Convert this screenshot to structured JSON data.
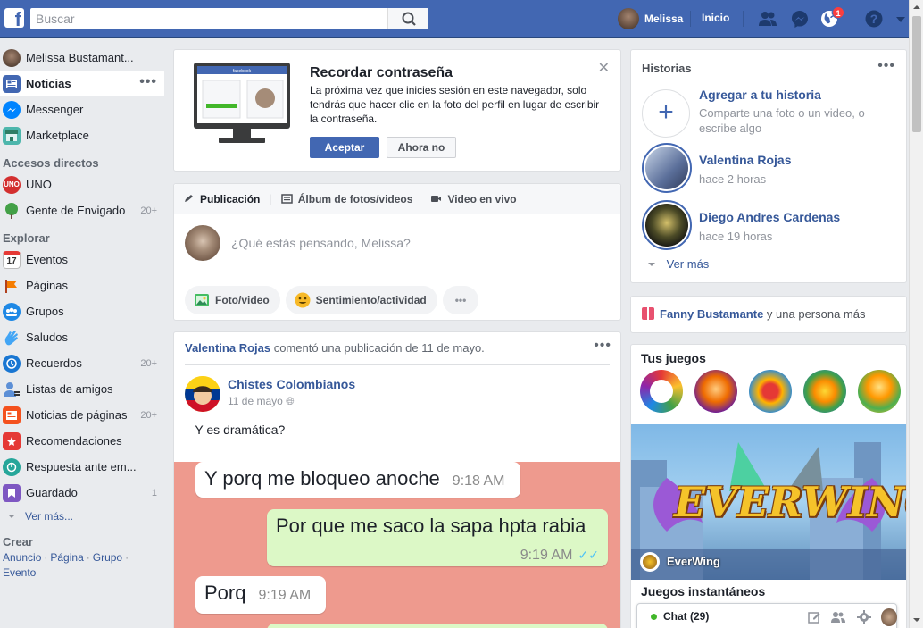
{
  "topbar": {
    "logo": "f",
    "search_placeholder": "Buscar",
    "user_name": "Melissa",
    "home_label": "Inicio",
    "notifications_count": "1"
  },
  "leftnav": {
    "profile_name": "Melissa Bustamant...",
    "main_items": [
      {
        "label": "Noticias",
        "icon": "news-feed-icon",
        "active": true
      },
      {
        "label": "Messenger",
        "icon": "messenger-icon"
      },
      {
        "label": "Marketplace",
        "icon": "marketplace-icon"
      }
    ],
    "shortcuts_header": "Accesos directos",
    "shortcuts": [
      {
        "label": "UNO",
        "icon": "uno-icon"
      },
      {
        "label": "Gente de Envigado",
        "icon": "tree-icon",
        "count": "20+"
      }
    ],
    "explore_header": "Explorar",
    "explore": [
      {
        "label": "Eventos",
        "icon": "calendar-icon",
        "badge": "17"
      },
      {
        "label": "Páginas",
        "icon": "flag-icon"
      },
      {
        "label": "Grupos",
        "icon": "groups-icon"
      },
      {
        "label": "Saludos",
        "icon": "wave-icon"
      },
      {
        "label": "Recuerdos",
        "icon": "memories-icon",
        "count": "20+"
      },
      {
        "label": "Listas de amigos",
        "icon": "friends-list-icon"
      },
      {
        "label": "Noticias de páginas",
        "icon": "pages-feed-icon",
        "count": "20+"
      },
      {
        "label": "Recomendaciones",
        "icon": "recommendations-icon"
      },
      {
        "label": "Respuesta ante em...",
        "icon": "crisis-response-icon"
      },
      {
        "label": "Guardado",
        "icon": "saved-icon",
        "count": "1"
      }
    ],
    "see_more": "Ver más...",
    "create_header": "Crear",
    "create_links": [
      "Anuncio",
      "Página",
      "Grupo",
      "Evento"
    ]
  },
  "password_card": {
    "title": "Recordar contraseña",
    "body": "La próxima vez que inicies sesión en este navegador, solo tendrás que hacer clic en la foto del perfil en lugar de escribir la contraseña.",
    "accept": "Aceptar",
    "decline": "Ahora no",
    "monitor_brand": "facebook"
  },
  "composer": {
    "tabs": [
      "Publicación",
      "Álbum de fotos/videos",
      "Video en vivo"
    ],
    "placeholder": "¿Qué estás pensando, Melissa?",
    "chips": [
      "Foto/video",
      "Sentimiento/actividad"
    ]
  },
  "post": {
    "actor": "Valentina Rojas",
    "activity": " comentó una publicación de 11 de mayo.",
    "page_name": "Chistes Colombianos",
    "date": "11 de mayo",
    "text_line1": "– Y es dramática?",
    "text_line2": "–",
    "messages": [
      {
        "text": "Y porq me bloqueo anoche",
        "time": "9:18 AM",
        "side": "in"
      },
      {
        "text": "Por que me saco la sapa hpta rabia",
        "time": "9:19 AM",
        "side": "out"
      },
      {
        "text": "Porq",
        "time": "9:19 AM",
        "side": "in"
      }
    ]
  },
  "stories": {
    "title": "Historias",
    "add_title": "Agregar a tu historia",
    "add_sub": "Comparte una foto o un video, o escribe algo",
    "items": [
      {
        "name": "Valentina Rojas",
        "time": "hace 2 horas"
      },
      {
        "name": "Diego Andres Cardenas",
        "time": "hace 19 horas"
      }
    ],
    "see_more": "Ver más"
  },
  "birthday": {
    "name": "Fanny Bustamante",
    "rest": " y una persona más"
  },
  "games": {
    "title": "Tus juegos",
    "featured_logo": "EVERWING",
    "featured_name": "EverWing",
    "instant_title": "Juegos instantáneos"
  },
  "chat": {
    "label": "Chat (29)"
  }
}
